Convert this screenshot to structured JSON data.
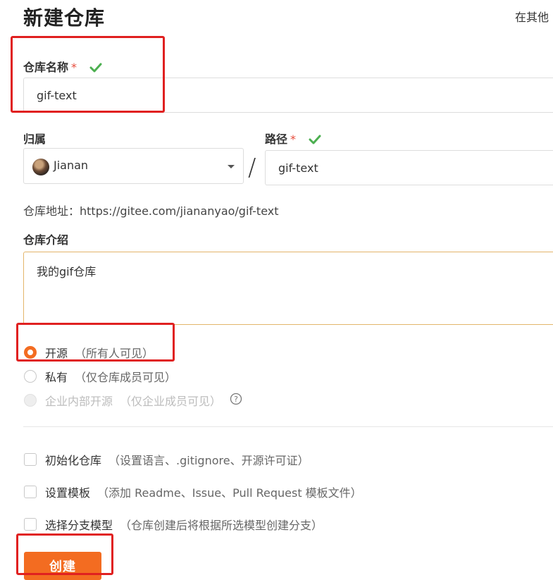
{
  "page": {
    "title": "新建仓库",
    "import_link": "在其他"
  },
  "repo_name": {
    "label": "仓库名称",
    "required_mark": "*",
    "value": "gif-text"
  },
  "owner": {
    "label": "归属",
    "value": "Jianan"
  },
  "path": {
    "label": "路径",
    "required_mark": "*",
    "value": "gif-text",
    "separator": "/"
  },
  "address": {
    "text": "仓库地址：https://gitee.com/jiananyao/gif-text"
  },
  "description": {
    "label": "仓库介绍",
    "value": "我的gif仓库"
  },
  "visibility": [
    {
      "label": "开源",
      "note": "（所有人可见）",
      "selected": true,
      "disabled": false
    },
    {
      "label": "私有",
      "note": "（仅仓库成员可见）",
      "selected": false,
      "disabled": false
    },
    {
      "label": "企业内部开源",
      "note": "（仅企业成员可见）",
      "selected": false,
      "disabled": true
    }
  ],
  "options": [
    {
      "label": "初始化仓库",
      "note": "（设置语言、.gitignore、开源许可证）",
      "checked": false
    },
    {
      "label": "设置模板",
      "note": "（添加 Readme、Issue、Pull Request 模板文件）",
      "checked": false
    },
    {
      "label": "选择分支模型",
      "note": "（仓库创建后将根据所选模型创建分支）",
      "checked": false
    }
  ],
  "submit": {
    "label": "创建"
  },
  "colors": {
    "accent": "#f36c21",
    "check_green": "#4caf50",
    "required_red": "#e74c3c",
    "annotation_red": "#e02020"
  },
  "icons": {
    "valid": "check-icon",
    "help": "help-icon",
    "dropdown": "caret-down-icon"
  }
}
